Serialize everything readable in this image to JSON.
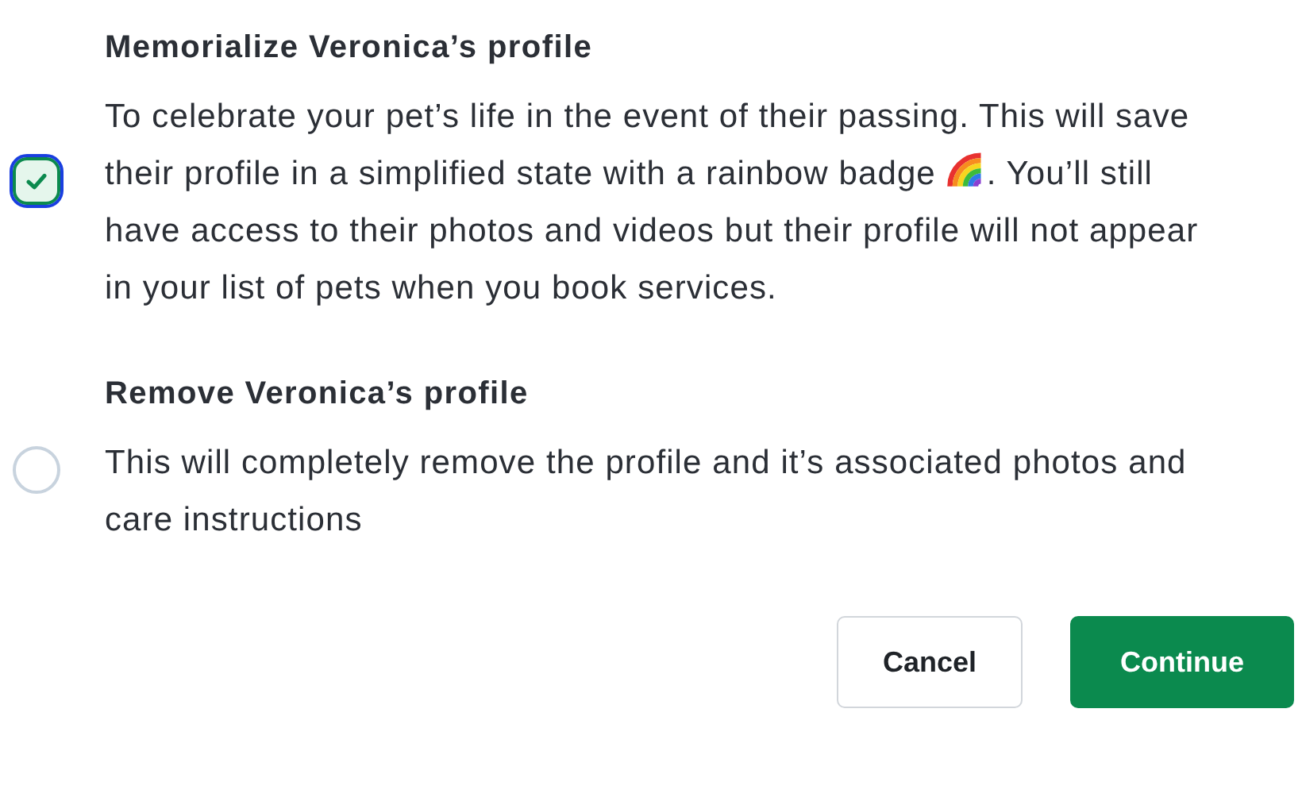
{
  "options": [
    {
      "title": "Memorialize Veronica’s profile",
      "description_before_icon": "To celebrate your pet’s life in the event of their passing. This will save their profile in a simplified state with a rainbow badge",
      "description_after_icon": ". You’ll still have access to their photos and videos but their profile will not appear in your list of pets when you book services.",
      "selected": true
    },
    {
      "title": "Remove Veronica’s profile",
      "description_before_icon": "This will completely remove the profile and it’s associated photos and care instructions",
      "selected": false
    }
  ],
  "buttons": [
    {
      "label": "Cancel",
      "kind": "secondary"
    },
    {
      "label": "Continue",
      "kind": "primary"
    }
  ]
}
